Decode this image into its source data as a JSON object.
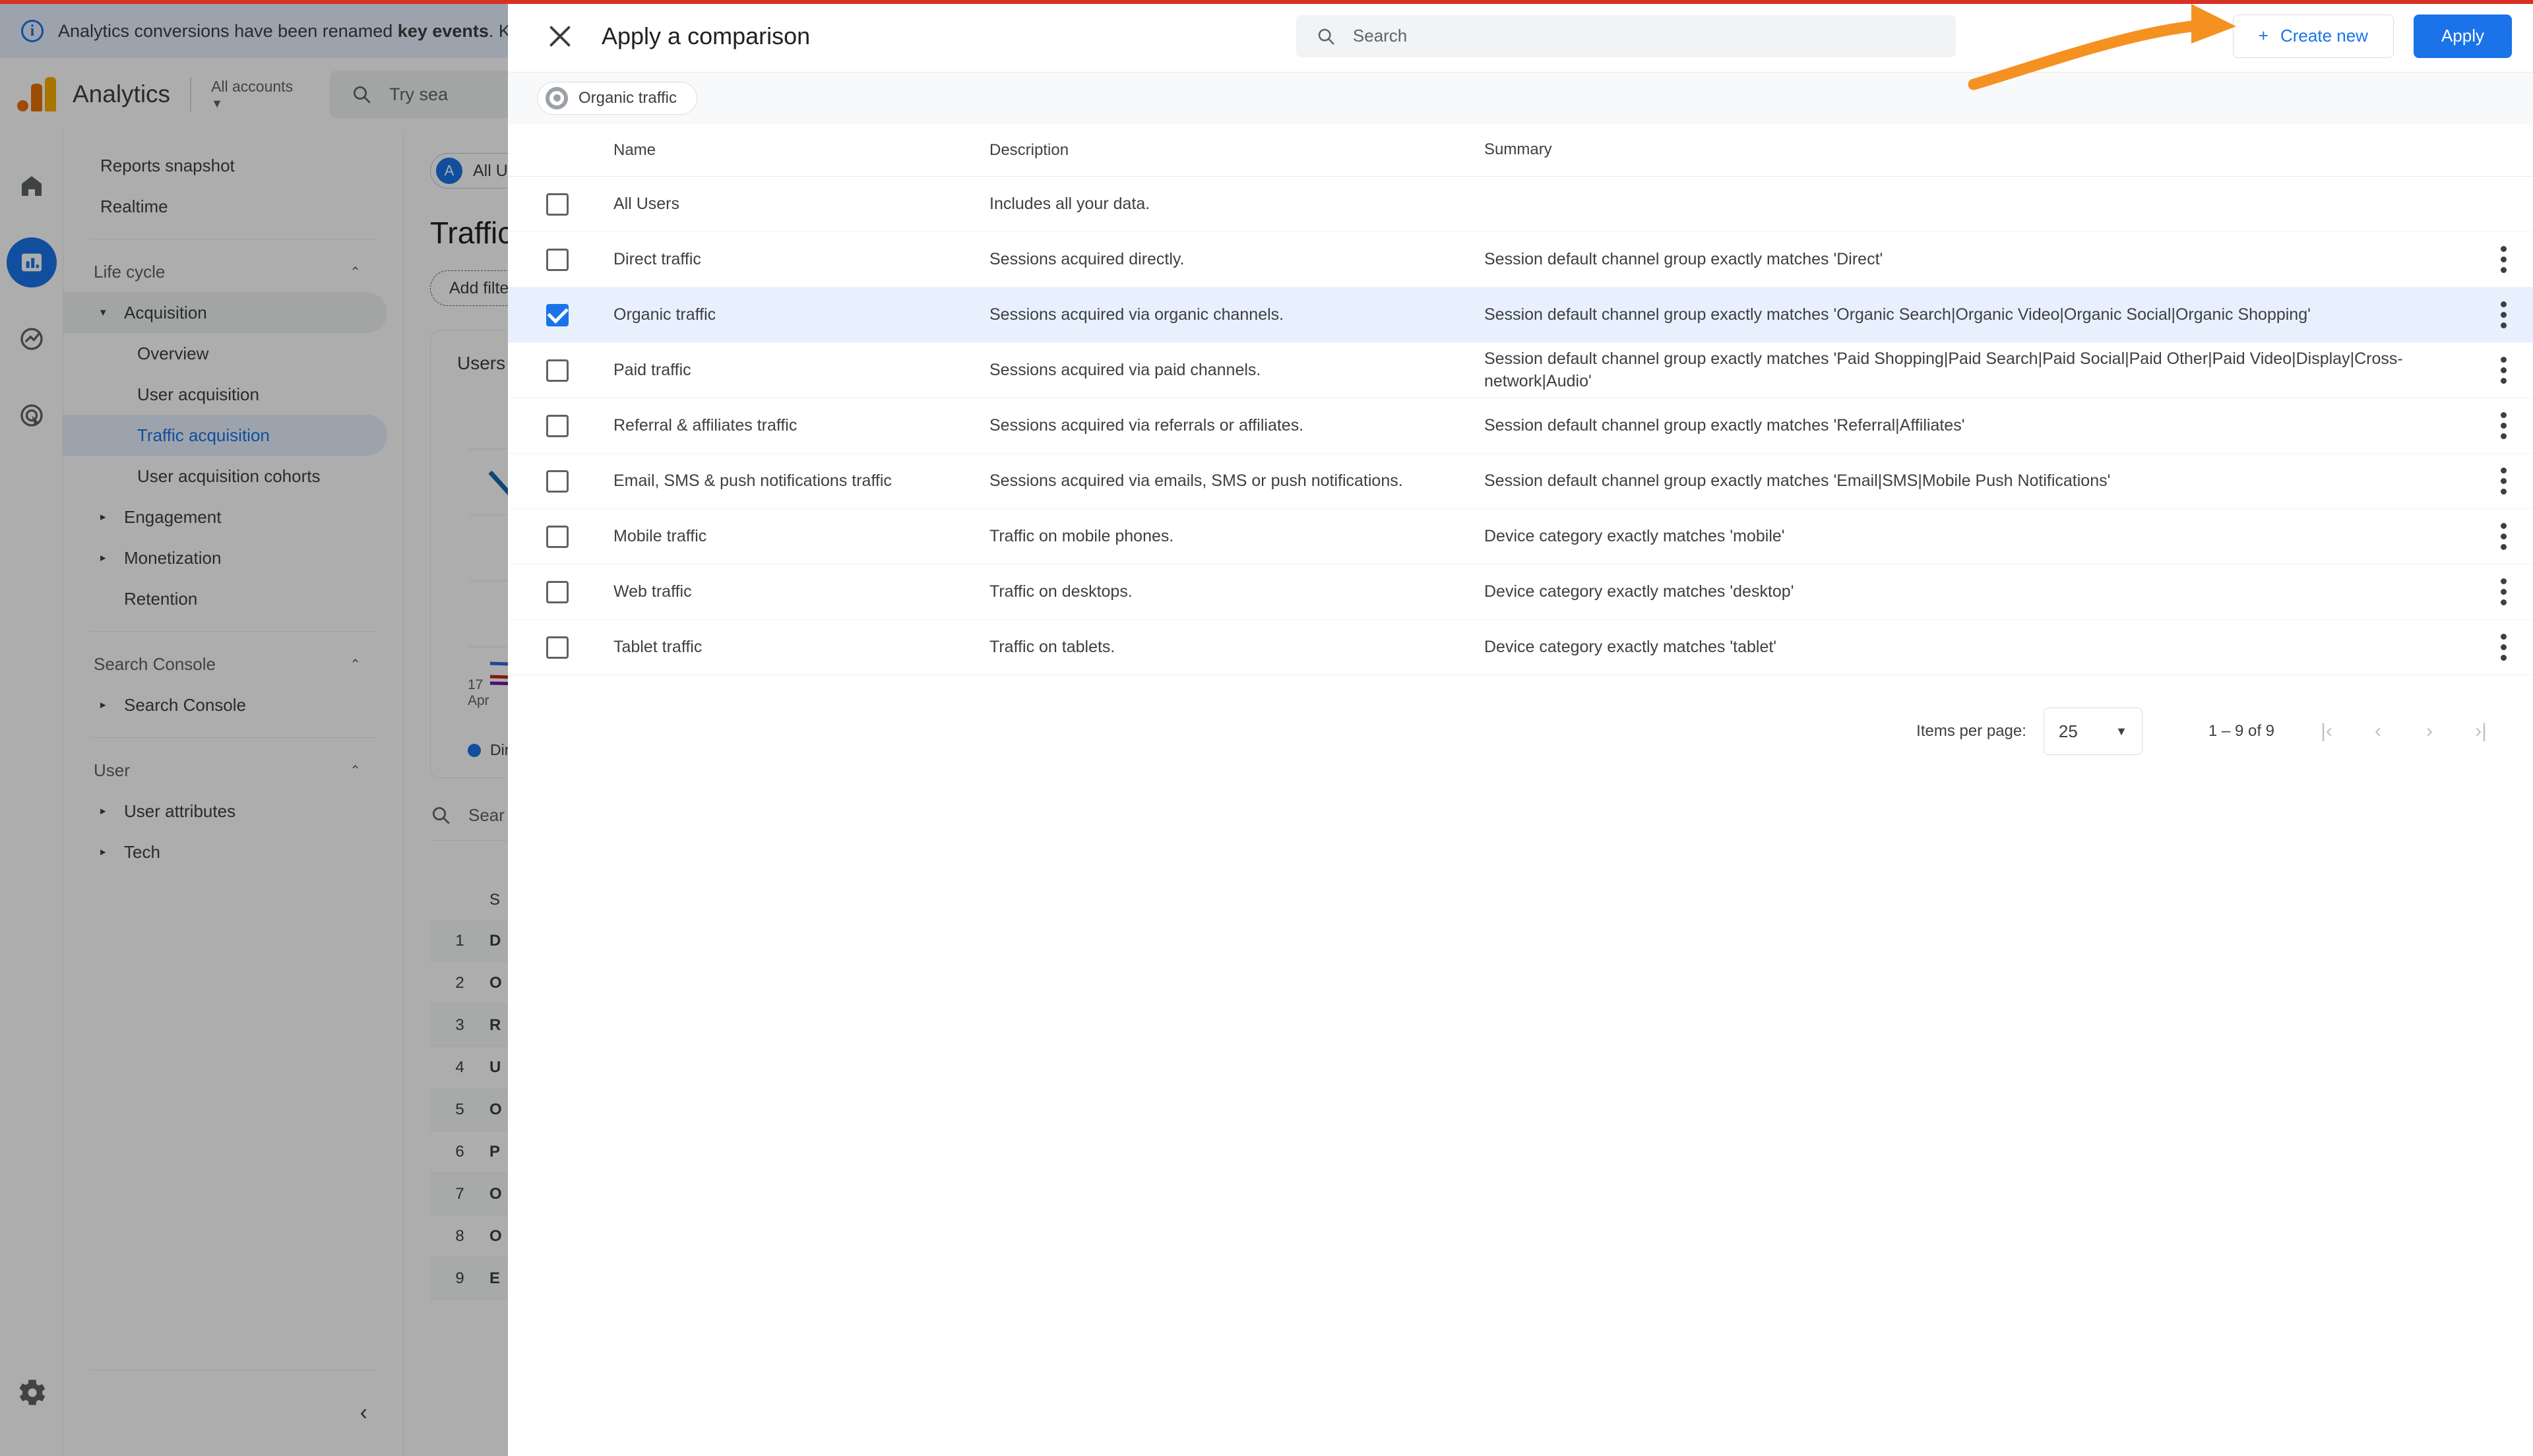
{
  "notice": {
    "text_before": "Analytics conversions have been renamed ",
    "text_bold": "key events",
    "text_after": ". Key e",
    "icon": "info-icon"
  },
  "app_header": {
    "product_name": "Analytics",
    "account_selector_label": "All accounts",
    "search_placeholder": "Try sea",
    "search_icon": "search-icon",
    "logo_icon": "google-analytics-logo"
  },
  "rail": {
    "items": [
      {
        "name": "home",
        "icon": "home-icon",
        "active": false
      },
      {
        "name": "reports",
        "icon": "bar-chart-icon",
        "active": true
      },
      {
        "name": "explore",
        "icon": "explore-trend-icon",
        "active": false
      },
      {
        "name": "advertising",
        "icon": "advertising-target-icon",
        "active": false
      }
    ],
    "settings_icon": "gear-icon"
  },
  "sidebar": {
    "top_items": [
      {
        "label": "Reports snapshot"
      },
      {
        "label": "Realtime"
      }
    ],
    "sections": [
      {
        "title": "Life cycle",
        "caret": "chevron-up-icon",
        "items": [
          {
            "label": "Acquisition",
            "arrow": "▾",
            "expanded": true,
            "state": "group-active"
          },
          {
            "label": "Overview",
            "sub": true
          },
          {
            "label": "User acquisition",
            "sub": true
          },
          {
            "label": "Traffic acquisition",
            "sub": true,
            "state": "selected"
          },
          {
            "label": "User acquisition cohorts",
            "sub": true
          },
          {
            "label": "Engagement",
            "arrow": "▸"
          },
          {
            "label": "Monetization",
            "arrow": "▸"
          },
          {
            "label": "Retention"
          }
        ]
      },
      {
        "title": "Search Console",
        "caret": "chevron-up-icon",
        "items": [
          {
            "label": "Search Console",
            "arrow": "▸"
          }
        ]
      },
      {
        "title": "User",
        "caret": "chevron-up-icon",
        "items": [
          {
            "label": "User attributes",
            "arrow": "▸"
          },
          {
            "label": "Tech",
            "arrow": "▸"
          }
        ]
      }
    ],
    "collapse_icon": "chevron-left-icon"
  },
  "background_report": {
    "audience_chip": {
      "avatar": "A",
      "label": "All Users"
    },
    "page_title": "Traffic acc",
    "add_filter_label": "Add filter",
    "add_filter_icon": "plus-icon",
    "card_title": "Users by S",
    "axis_label_line1": "17",
    "axis_label_line2": "Apr",
    "legend_item": "Direct",
    "table_search_placeholder": "Sear",
    "table_header_partial": "S",
    "rows": [
      {
        "index": "1",
        "name": "D"
      },
      {
        "index": "2",
        "name": "O"
      },
      {
        "index": "3",
        "name": "R"
      },
      {
        "index": "4",
        "name": "U"
      },
      {
        "index": "5",
        "name": "O"
      },
      {
        "index": "6",
        "name": "P"
      },
      {
        "index": "7",
        "name": "O"
      },
      {
        "index": "8",
        "name": "O"
      },
      {
        "index": "9",
        "name": "E"
      }
    ]
  },
  "modal": {
    "title": "Apply a comparison",
    "close_icon": "close-icon",
    "search": {
      "placeholder": "Search",
      "value": "",
      "icon": "search-icon"
    },
    "create_new_label": "Create new",
    "create_new_icon": "plus-icon",
    "apply_label": "Apply",
    "applied_chips": [
      {
        "label": "Organic traffic",
        "icon": "comparison-ring-icon"
      }
    ],
    "table": {
      "columns": [
        "Name",
        "Description",
        "Summary"
      ],
      "rows": [
        {
          "checked": false,
          "name": "All Users",
          "description": "Includes all your data.",
          "summary": "",
          "has_menu": false
        },
        {
          "checked": false,
          "name": "Direct traffic",
          "description": "Sessions acquired directly.",
          "summary": "Session default channel group exactly matches 'Direct'",
          "has_menu": true
        },
        {
          "checked": true,
          "name": "Organic traffic",
          "description": "Sessions acquired via organic channels.",
          "summary": "Session default channel group exactly matches 'Organic Search|Organic Video|Organic Social|Organic Shopping'",
          "has_menu": true
        },
        {
          "checked": false,
          "name": "Paid traffic",
          "description": "Sessions acquired via paid channels.",
          "summary": "Session default channel group exactly matches 'Paid Shopping|Paid Search|Paid Social|Paid Other|Paid Video|Display|Cross-network|Audio'",
          "has_menu": true
        },
        {
          "checked": false,
          "name": "Referral & affiliates traffic",
          "description": "Sessions acquired via referrals or affiliates.",
          "summary": "Session default channel group exactly matches 'Referral|Affiliates'",
          "has_menu": true
        },
        {
          "checked": false,
          "name": "Email, SMS & push notifications traffic",
          "description": "Sessions acquired via emails, SMS or push notifications.",
          "summary": "Session default channel group exactly matches 'Email|SMS|Mobile Push Notifications'",
          "has_menu": true
        },
        {
          "checked": false,
          "name": "Mobile traffic",
          "description": "Traffic on mobile phones.",
          "summary": "Device category exactly matches 'mobile'",
          "has_menu": true
        },
        {
          "checked": false,
          "name": "Web traffic",
          "description": "Traffic on desktops.",
          "summary": "Device category exactly matches 'desktop'",
          "has_menu": true
        },
        {
          "checked": false,
          "name": "Tablet traffic",
          "description": "Traffic on tablets.",
          "summary": "Device category exactly matches 'tablet'",
          "has_menu": true
        }
      ]
    },
    "pagination": {
      "items_per_page_label": "Items per page:",
      "items_per_page_value": "25",
      "range_label": "1 – 9 of 9",
      "first_icon": "first-page-icon",
      "prev_icon": "prev-page-icon",
      "next_icon": "next-page-icon",
      "last_icon": "last-page-icon"
    }
  },
  "annotation": {
    "arrow_color": "#f59121",
    "arrow_name": "orange-curved-arrow"
  },
  "colors": {
    "accent_blue": "#1a73e8",
    "selected_row": "#e8f0fe",
    "notice_bg": "#e8f0fe",
    "top_strip": "#d93025",
    "arrow_orange": "#f59121"
  }
}
